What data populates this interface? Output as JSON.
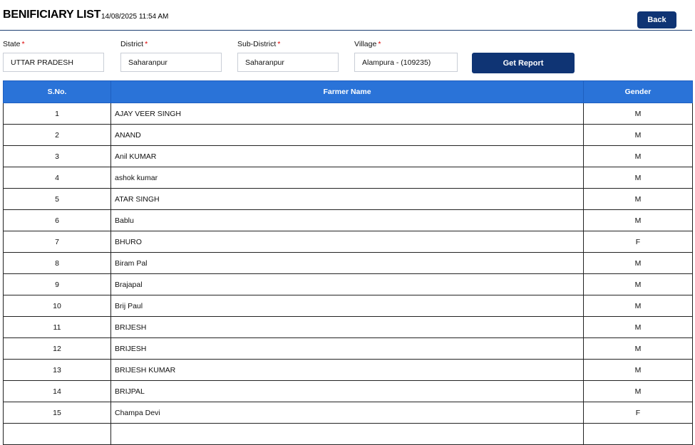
{
  "page": {
    "title": "BENIFICIARY LIST",
    "timestamp": "14/08/2025 11:54 AM",
    "back_label": "Back"
  },
  "filters": {
    "state": {
      "label": "State",
      "required_mark": "*",
      "value": "UTTAR PRADESH"
    },
    "district": {
      "label": "District",
      "required_mark": "*",
      "value": "Saharanpur"
    },
    "sub_district": {
      "label": "Sub-District",
      "required_mark": "*",
      "value": "Saharanpur"
    },
    "village": {
      "label": "Village",
      "required_mark": "*",
      "value": "Alampura - (109235)"
    },
    "get_report_label": "Get Report"
  },
  "table": {
    "headers": {
      "sno": "S.No.",
      "name": "Farmer Name",
      "gender": "Gender"
    },
    "rows": [
      {
        "sno": "1",
        "name": "AJAY VEER SINGH",
        "gender": "M"
      },
      {
        "sno": "2",
        "name": "ANAND",
        "gender": "M"
      },
      {
        "sno": "3",
        "name": "Anil KUMAR",
        "gender": "M"
      },
      {
        "sno": "4",
        "name": "ashok kumar",
        "gender": "M"
      },
      {
        "sno": "5",
        "name": "ATAR SINGH",
        "gender": "M"
      },
      {
        "sno": "6",
        "name": "Bablu",
        "gender": "M"
      },
      {
        "sno": "7",
        "name": "BHURO",
        "gender": "F"
      },
      {
        "sno": "8",
        "name": "Biram Pal",
        "gender": "M"
      },
      {
        "sno": "9",
        "name": "Brajapal",
        "gender": "M"
      },
      {
        "sno": "10",
        "name": "Brij Paul",
        "gender": "M"
      },
      {
        "sno": "11",
        "name": "BRIJESH",
        "gender": "M"
      },
      {
        "sno": "12",
        "name": "BRIJESH",
        "gender": "M"
      },
      {
        "sno": "13",
        "name": "BRIJESH KUMAR",
        "gender": "M"
      },
      {
        "sno": "14",
        "name": "BRIJPAL",
        "gender": "M"
      },
      {
        "sno": "15",
        "name": "Champa Devi",
        "gender": "F"
      },
      {
        "sno": "",
        "name": "",
        "gender": ""
      }
    ]
  }
}
